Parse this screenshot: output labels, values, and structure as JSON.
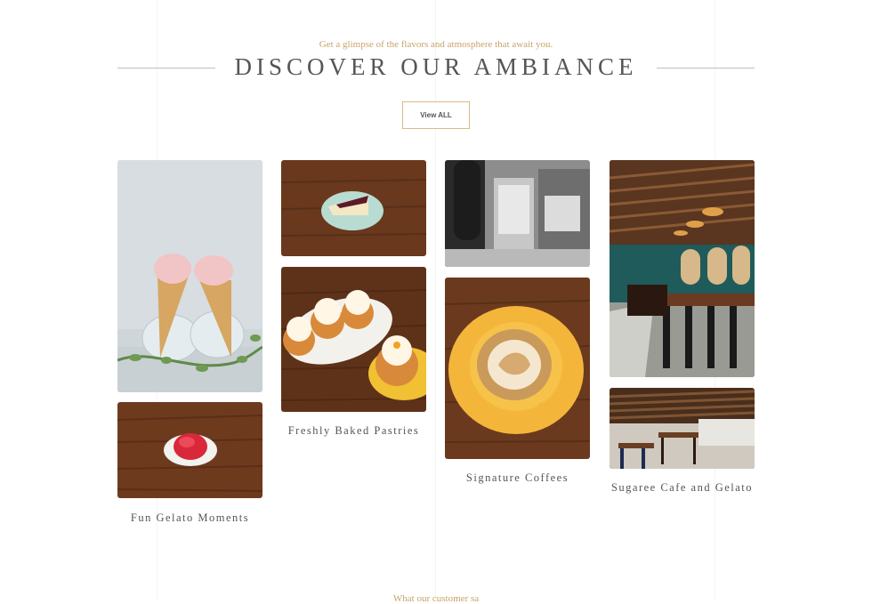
{
  "header": {
    "subtitle": "Get a glimpse of the flavors and atmosphere that await you.",
    "title": "DISCOVER OUR AMBIANCE",
    "view_all_label": "View ALL"
  },
  "gallery": {
    "captions": {
      "gelato": "Fun Gelato Moments",
      "pastries": "Freshly Baked Pastries",
      "coffee": "Signature Coffees",
      "cafe": "Sugaree Cafe and Gelato"
    }
  },
  "next_section": {
    "subtitle": "What our customer sa"
  }
}
